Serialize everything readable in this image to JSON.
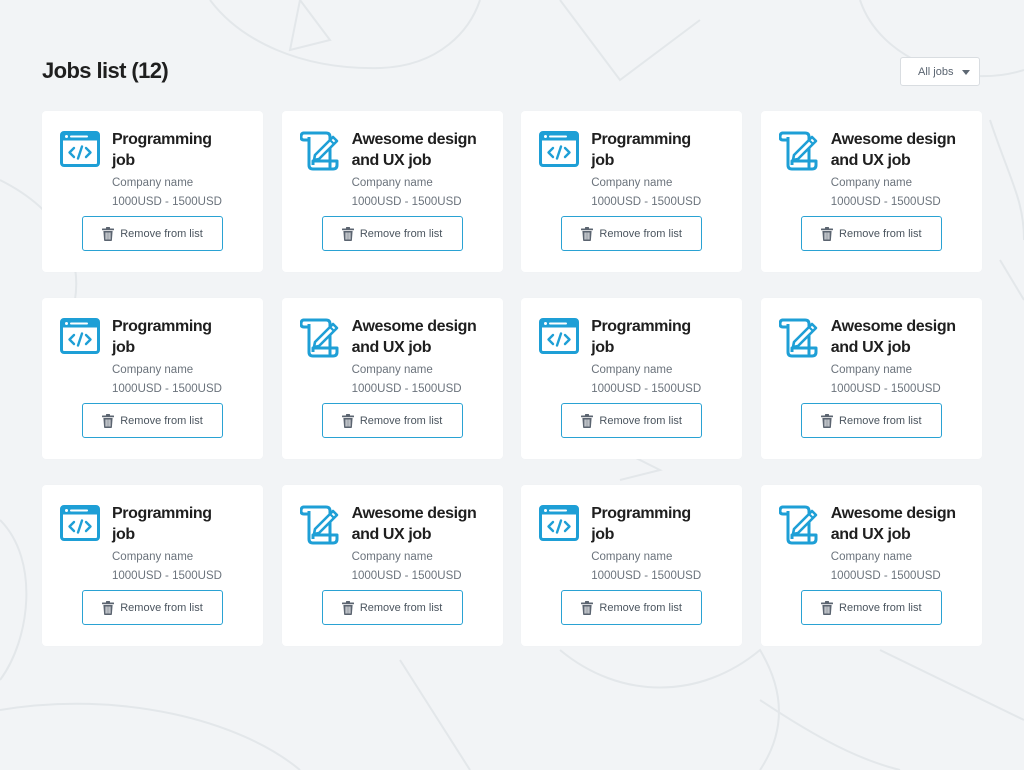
{
  "header": {
    "title": "Jobs list (12)",
    "filter": {
      "selected": "All jobs",
      "icon": "caret-down-icon"
    }
  },
  "colors": {
    "accent": "#2aa2d3",
    "background": "#f2f4f6",
    "card": "#ffffff",
    "title": "#1f1f1f",
    "muted": "#6b737c"
  },
  "jobs": [
    {
      "type": "programming",
      "icon": "code-window-icon",
      "title": "Programming job",
      "company": "Company name",
      "salary": "1000USD - 1500USD",
      "remove_label": "Remove from list"
    },
    {
      "type": "design",
      "icon": "design-scroll-icon",
      "title": "Awesome design and UX job",
      "company": "Company name",
      "salary": "1000USD - 1500USD",
      "remove_label": "Remove from list"
    },
    {
      "type": "programming",
      "icon": "code-window-icon",
      "title": "Programming job",
      "company": "Company name",
      "salary": "1000USD - 1500USD",
      "remove_label": "Remove from list"
    },
    {
      "type": "design",
      "icon": "design-scroll-icon",
      "title": "Awesome design and UX job",
      "company": "Company name",
      "salary": "1000USD - 1500USD",
      "remove_label": "Remove from list"
    },
    {
      "type": "programming",
      "icon": "code-window-icon",
      "title": "Programming job",
      "company": "Company name",
      "salary": "1000USD - 1500USD",
      "remove_label": "Remove from list"
    },
    {
      "type": "design",
      "icon": "design-scroll-icon",
      "title": "Awesome design and UX job",
      "company": "Company name",
      "salary": "1000USD - 1500USD",
      "remove_label": "Remove from list"
    },
    {
      "type": "programming",
      "icon": "code-window-icon",
      "title": "Programming job",
      "company": "Company name",
      "salary": "1000USD - 1500USD",
      "remove_label": "Remove from list"
    },
    {
      "type": "design",
      "icon": "design-scroll-icon",
      "title": "Awesome design and UX job",
      "company": "Company name",
      "salary": "1000USD - 1500USD",
      "remove_label": "Remove from list"
    },
    {
      "type": "programming",
      "icon": "code-window-icon",
      "title": "Programming job",
      "company": "Company name",
      "salary": "1000USD - 1500USD",
      "remove_label": "Remove from list"
    },
    {
      "type": "design",
      "icon": "design-scroll-icon",
      "title": "Awesome design and UX job",
      "company": "Company name",
      "salary": "1000USD - 1500USD",
      "remove_label": "Remove from list"
    },
    {
      "type": "programming",
      "icon": "code-window-icon",
      "title": "Programming job",
      "company": "Company name",
      "salary": "1000USD - 1500USD",
      "remove_label": "Remove from list"
    },
    {
      "type": "design",
      "icon": "design-scroll-icon",
      "title": "Awesome design and UX job",
      "company": "Company name",
      "salary": "1000USD - 1500USD",
      "remove_label": "Remove from list"
    }
  ]
}
